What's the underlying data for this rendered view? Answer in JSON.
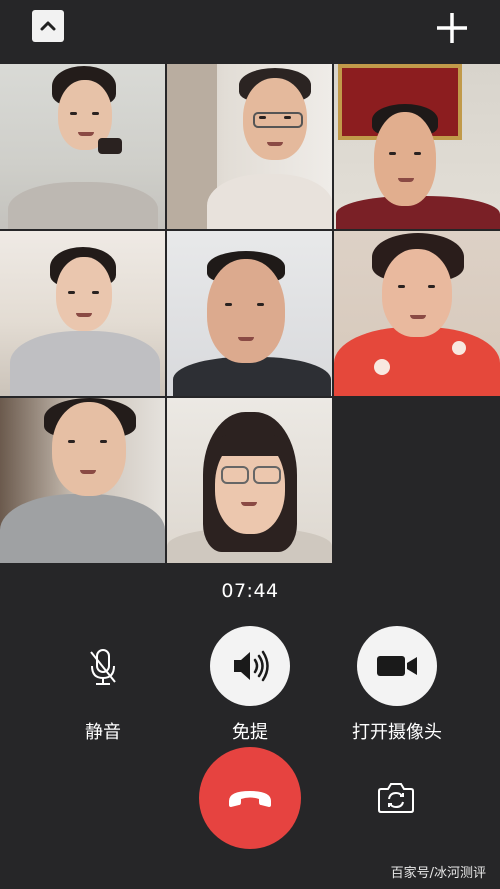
{
  "header": {
    "collapse_icon": "chevron-up-icon",
    "add_icon": "plus-icon"
  },
  "participants": [
    {
      "name": "participant-1"
    },
    {
      "name": "participant-2"
    },
    {
      "name": "participant-3"
    },
    {
      "name": "participant-4"
    },
    {
      "name": "participant-5"
    },
    {
      "name": "participant-6"
    },
    {
      "name": "participant-7"
    },
    {
      "name": "participant-8"
    }
  ],
  "call": {
    "timer": "07:44"
  },
  "controls": {
    "mute_label": "静音",
    "speaker_label": "免提",
    "camera_label": "打开摄像头",
    "hangup_icon": "phone-hangup-icon",
    "flip_icon": "camera-switch-icon"
  },
  "watermark": "百家号/冰河测评",
  "colors": {
    "background": "#262628",
    "hangup": "#e64340",
    "button": "#f3f3f3"
  }
}
